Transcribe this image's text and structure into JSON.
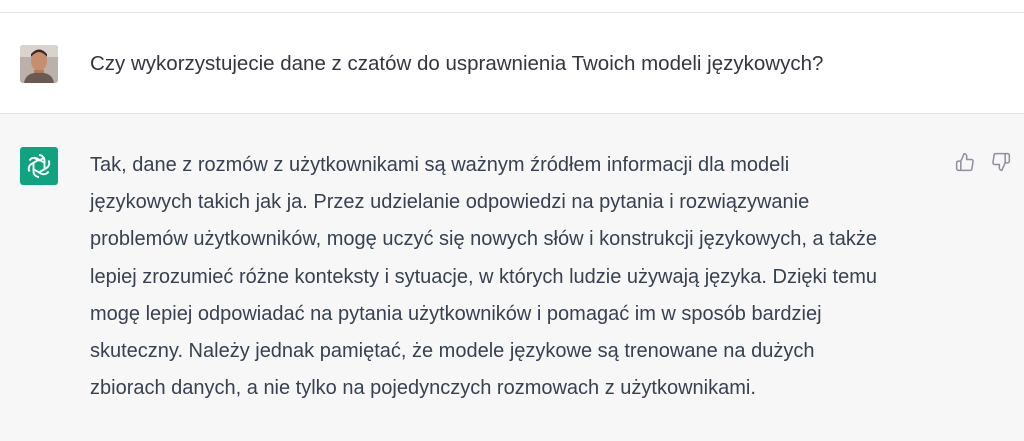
{
  "conversation": {
    "user_message": {
      "avatar": "user-photo-avatar",
      "text": "Czy wykorzystujecie dane z czatów do usprawnienia Twoich modeli językowych?"
    },
    "assistant_message": {
      "avatar": "openai-logo-icon",
      "lines": [
        "Tak, dane z rozmów z użytkownikami są ważnym źródłem informacji dla modeli",
        "językowych takich jak ja. Przez udzielanie odpowiedzi na pytania i rozwiązywanie",
        "problemów użytkowników, mogę uczyć się nowych słów i konstrukcji językowych, a także",
        "lepiej zrozumieć różne konteksty i sytuacje, w których ludzie używają języka. Dzięki temu",
        "mogę lepiej odpowiadać na pytania użytkowników i pomagać im w sposób bardziej",
        "skuteczny. Należy jednak pamiętać, że modele językowe są trenowane na dużych",
        "zbiorach danych, a nie tylko na pojedynczych rozmowach z użytkownikami."
      ],
      "feedback_icons": [
        "thumbs-up-icon",
        "thumbs-down-icon"
      ]
    }
  },
  "colors": {
    "assistant_bg": "#f7f7f8",
    "bot_avatar_bg": "#10a37f",
    "text": "#374151"
  }
}
